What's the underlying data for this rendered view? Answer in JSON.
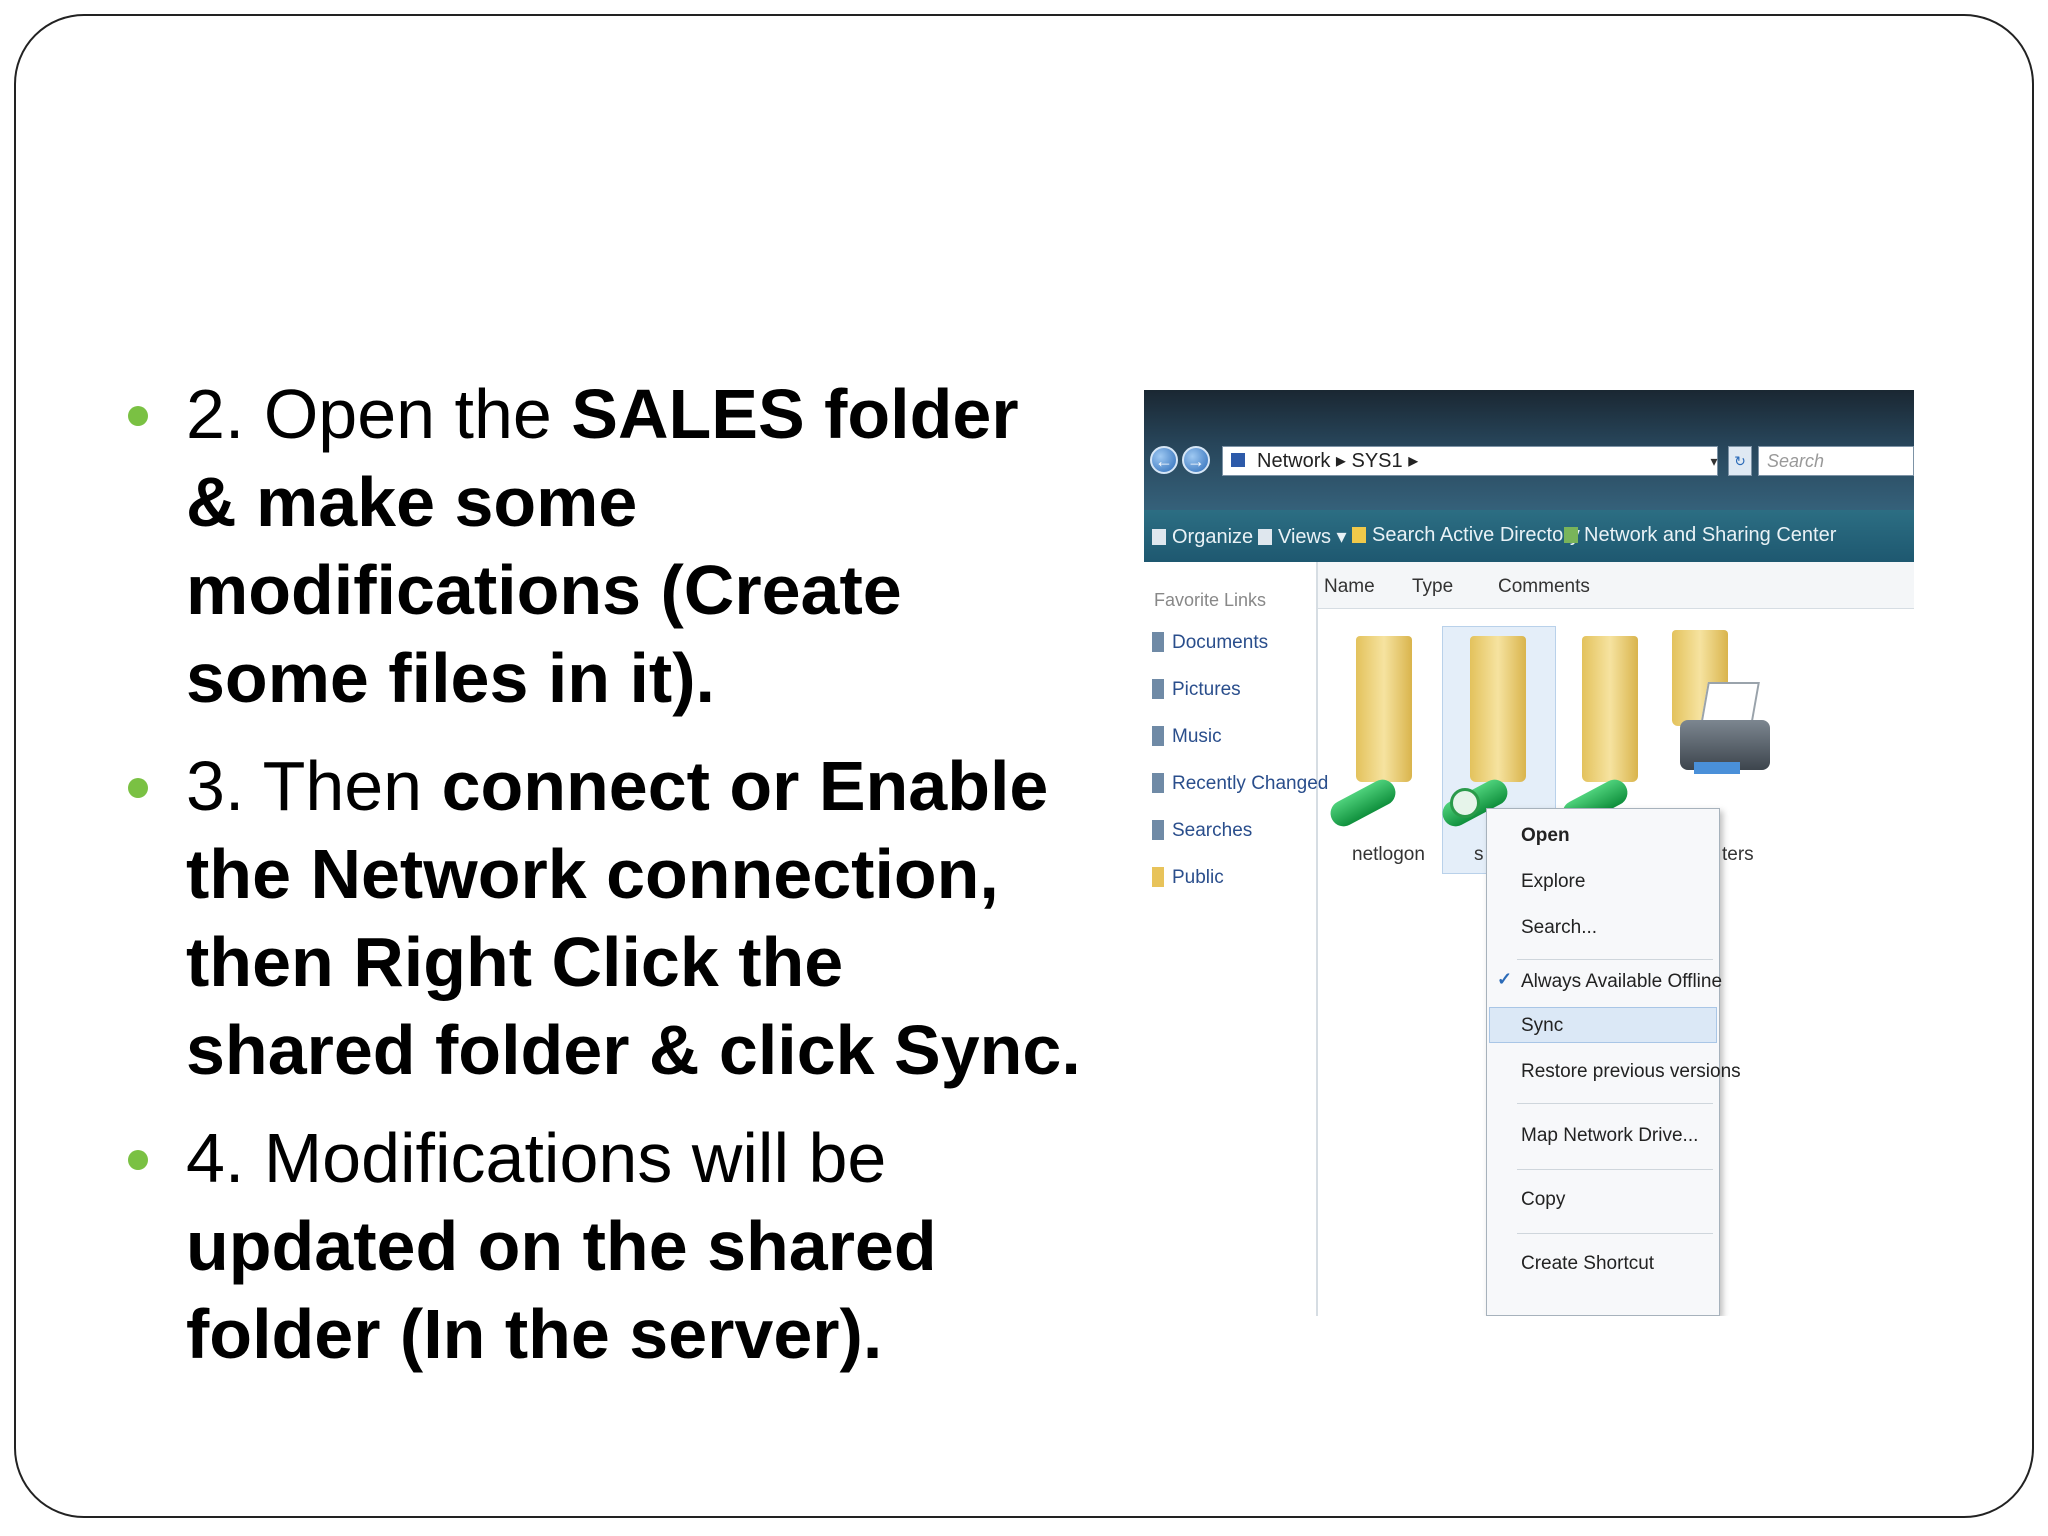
{
  "bullets": [
    {
      "prefix": "2. Open the ",
      "bold": "SALES folder & make some modifications (Create some files in it)."
    },
    {
      "prefix": "3. Then ",
      "bold": "connect or Enable the Network connection, then Right Click the shared folder & click Sync."
    },
    {
      "prefix": "4. Modifications will be ",
      "bold": "updated on the shared folder (In the server)."
    }
  ],
  "screenshot": {
    "address": "Network ▸ SYS1 ▸",
    "search_placeholder": "Search",
    "toolbar": [
      "Organize ▾",
      "Views ▾",
      "Search Active Directory",
      "Network and Sharing Center"
    ],
    "favorites_header": "Favorite Links",
    "favorites": [
      "Documents",
      "Pictures",
      "Music",
      "Recently Changed",
      "Searches",
      "Public"
    ],
    "columns": [
      "Name",
      "Type",
      "Comments"
    ],
    "items": [
      "netlogon",
      "s",
      "ters"
    ],
    "context_menu": [
      "Open",
      "Explore",
      "Search...",
      "Always Available Offline",
      "Sync",
      "Restore previous versions",
      "Map Network Drive...",
      "Copy",
      "Create Shortcut"
    ],
    "check_mark": "✓"
  },
  "colors": {
    "bullet": "#7ac143",
    "frame": "#222222"
  }
}
